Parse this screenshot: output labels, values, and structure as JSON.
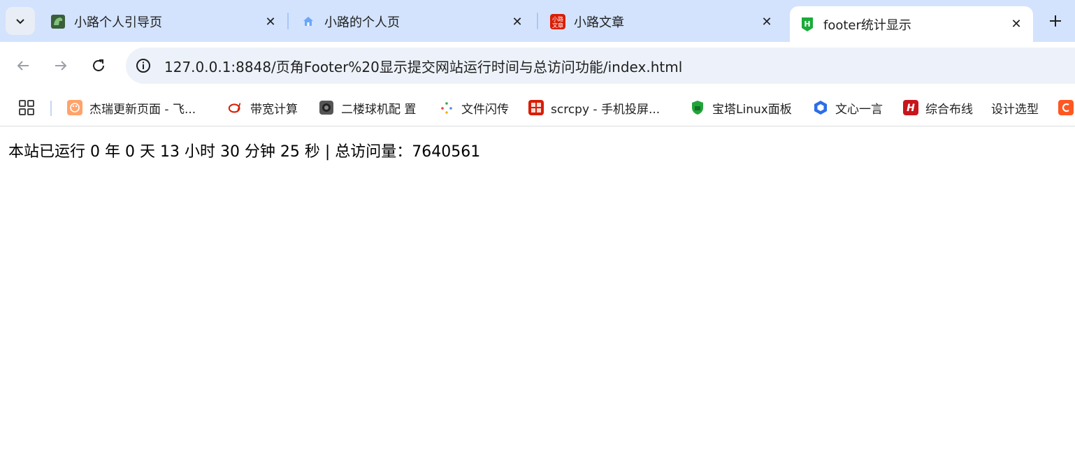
{
  "tabs": [
    {
      "title": "小路个人引导页",
      "icon": "dinosaur-icon"
    },
    {
      "title": "小路的个人页",
      "icon": "home-icon"
    },
    {
      "title": "小路文章",
      "icon": "red-badge-icon",
      "badge_text": "小路\n文章"
    },
    {
      "title": "footer统计显示",
      "icon": "hbuilder-icon",
      "active": true
    }
  ],
  "toolbar": {
    "url": "127.0.0.1:8848/页角Footer%20显示提交网站运行时间与总访问功能/index.html"
  },
  "bookmarks": [
    {
      "label": "杰瑞更新页面 - 飞...",
      "icon": "palette-icon"
    },
    {
      "label": "带宽计算",
      "icon": "ai-logo-icon"
    },
    {
      "label": "二楼球机配 置",
      "icon": "camera-icon"
    },
    {
      "label": "文件闪传",
      "icon": "sparkle-icon"
    },
    {
      "label": "scrcpy - 手机投屏...",
      "icon": "red-seal-icon"
    },
    {
      "label": "宝塔Linux面板",
      "icon": "shield-icon"
    },
    {
      "label": "文心一言",
      "icon": "hexagon-icon"
    },
    {
      "label": "综合布线",
      "icon": "h-logo-icon"
    },
    {
      "label": "设计选型",
      "icon": ""
    }
  ],
  "page": {
    "footer_text": "本站已运行 0 年 0 天 13 小时 30 分钟 25 秒 | 总访问量：7640561"
  },
  "colors": {
    "tabstrip_bg": "#d3e3fd",
    "omnibox_bg": "#edf2fa",
    "accent_green": "#1aab3a",
    "accent_red": "#d81e06"
  }
}
